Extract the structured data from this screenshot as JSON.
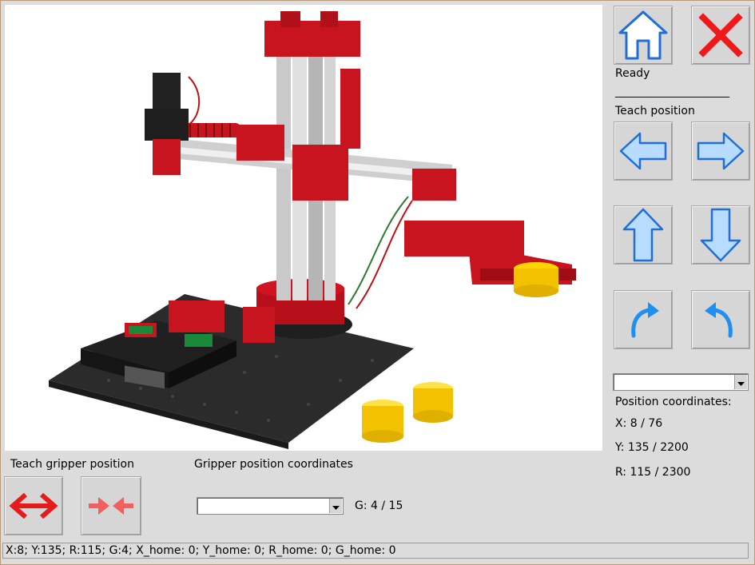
{
  "status_text": "Ready",
  "divider_text": "______________________",
  "teach_position_label": "Teach position",
  "position_coordinates_label": "Position coordinates:",
  "coords": {
    "x": "X: 8   / 76",
    "y": "Y: 135   / 2200",
    "r": "R: 115   / 2300"
  },
  "teach_gripper_label": "Teach gripper position",
  "gripper_coords_label": "Gripper position coordinates",
  "gripper_value": "G:    4   / 15",
  "position_select_value": "",
  "gripper_select_value": "",
  "statusbar_text": "X:8; Y:135; R:115; G:4; X_home: 0; Y_home: 0; R_home: 0; G_home: 0",
  "colors": {
    "accent_blue": "#1f6fd6",
    "arrow_fill": "#b8dcff",
    "close_red": "#f01818",
    "gripper_red": "#e41c1c"
  },
  "icons": [
    "home-icon",
    "close-icon",
    "arrow-left-icon",
    "arrow-right-icon",
    "arrow-up-icon",
    "arrow-down-icon",
    "rotate-right-icon",
    "rotate-left-icon",
    "gripper-open-icon",
    "gripper-close-icon"
  ]
}
